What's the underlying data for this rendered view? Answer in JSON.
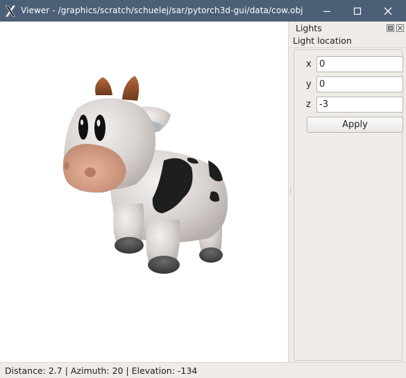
{
  "window": {
    "title": "Viewer - /graphics/scratch/schuelej/sar/pytorch3d-gui/data/cow.obj",
    "icon": "x11-app-icon",
    "controls": [
      "minimize-icon",
      "maximize-icon",
      "close-icon"
    ],
    "titlebar_color": "#4b6077"
  },
  "dock": {
    "title": "Lights",
    "group_title": "Light location",
    "fields": [
      {
        "label": "x",
        "value": "0"
      },
      {
        "label": "y",
        "value": "0"
      },
      {
        "label": "z",
        "value": "-3"
      }
    ],
    "apply_label": "Apply"
  },
  "status": {
    "text": "Distance: 2.7 | Azimuth: 20 | Elevation: -134"
  },
  "viewport": {
    "content": "rendered-3d-mesh"
  }
}
